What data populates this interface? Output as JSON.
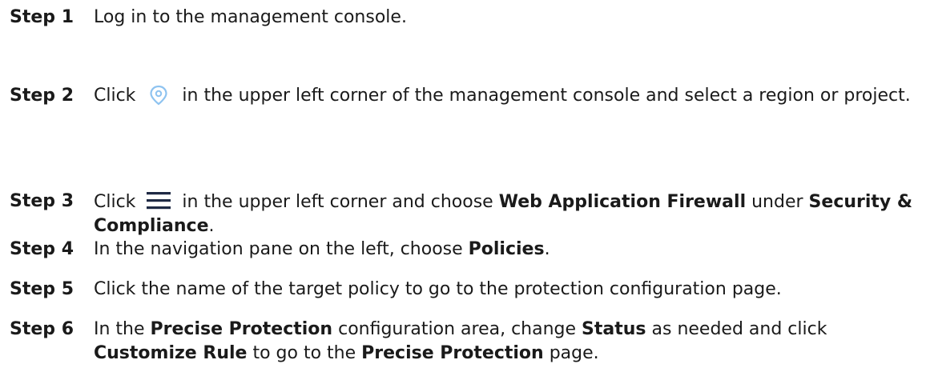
{
  "steps": [
    {
      "label": "Step 1",
      "text": "Log in to the management console."
    },
    {
      "label": "Step 2",
      "text_before_icon": "Click",
      "icon": "location-pin-icon",
      "text_after_icon": "in the upper left corner of the management console and select a region or project."
    },
    {
      "label": "Step 3",
      "text_before_icon": "Click",
      "icon": "hamburger-menu-icon",
      "text_after_icon": "in the upper left corner and choose",
      "bold_1": "Web Application Firewall",
      "text_mid": "under",
      "bold_2": "Security & Compliance",
      "text_end": "."
    },
    {
      "label": "Step 4",
      "text": "In the navigation pane on the left, choose",
      "bold_1": "Policies",
      "text_end": "."
    },
    {
      "label": "Step 5",
      "text": "Click the name of the target policy to go to the protection configuration page."
    },
    {
      "label": "Step 6",
      "text_1": "In the",
      "bold_1": "Precise Protection",
      "text_2": "configuration area, change",
      "bold_2": "Status",
      "text_3": "as needed and click",
      "bold_3": "Customize Rule",
      "text_4": "to go to the",
      "bold_4": "Precise Protection",
      "text_5": "page."
    }
  ],
  "colors": {
    "text": "#1a1a1a",
    "pin_icon": "#8ec3f0",
    "menu_icon": "#1f2a44"
  }
}
